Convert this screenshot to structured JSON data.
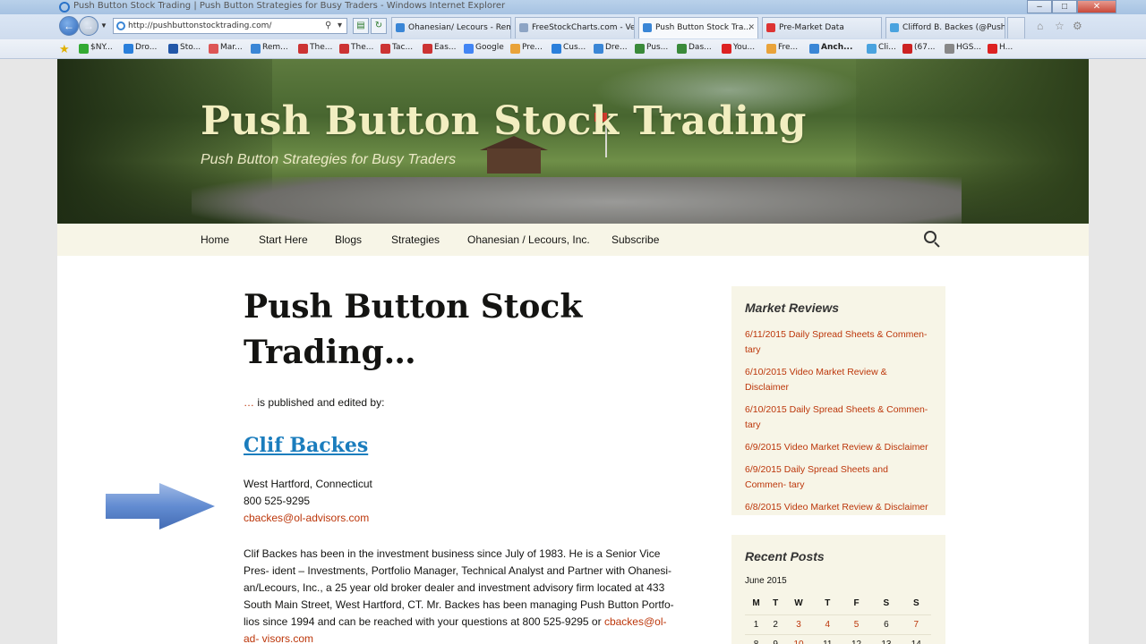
{
  "window": {
    "title": "Push Button Stock Trading | Push Button Strategies for Busy Traders - Windows Internet Explorer",
    "controls": [
      "–",
      "□",
      "✕"
    ]
  },
  "browser": {
    "address": "http://pushbuttonstocktrading.com/",
    "tabs": [
      {
        "label": "Ohanesian/ Lecours - Rem...",
        "active": false
      },
      {
        "label": "FreeStockCharts.com - Ve...",
        "active": false
      },
      {
        "label": "Push Button Stock Tra...",
        "active": true
      },
      {
        "label": "Pre-Market Data",
        "active": false
      },
      {
        "label": "Clifford B. Backes (@Push...",
        "active": false
      }
    ],
    "favorites": [
      "$NY...",
      "Dro...",
      "Sto...",
      "Mar...",
      "Rem...",
      "The...",
      "The...",
      "Tac...",
      "Eas...",
      "Google",
      "Pre...",
      "Cus...",
      "Dre...",
      "Pus...",
      "Das...",
      "You...",
      "Fre...",
      "Anch...",
      "Cli...",
      "(67...",
      "HGS...",
      "H..."
    ]
  },
  "site": {
    "title": "Push Button Stock Trading",
    "tagline": "Push Button Strategies for Busy Traders",
    "nav": [
      "Home",
      "Start Here",
      "Blogs",
      "Strategies",
      "Ohanesian / Lecours, Inc.",
      "Subscribe"
    ]
  },
  "entry": {
    "title": "Push Button Stock Trading…",
    "intro_dots": "…",
    "intro_text": " is published and edited by:",
    "person_name": "Clif Backes",
    "location": "West Hartford, Connecticut",
    "phone": "800 525-9295",
    "email": "cbackes@ol-advisors.com",
    "bio_text": "Clif Backes has been in the investment business since July of 1983. He is a Senior Vice Pres- ident – Investments, Portfolio Manager, Technical Analyst and Partner with Ohanesi- an/Lecours, Inc., a 25 year old broker dealer and investment advisory firm located at 433 South Main Street, West Hartford, CT.  Mr. Backes has been managing Push Button Portfo- lios since 1994 and can be reached with your questions at 800 525-9295 or ",
    "bio_email": "cbackes@ol-ad- visors.com"
  },
  "sidebar": {
    "market_reviews": {
      "title": "Market Reviews",
      "items": [
        "6/11/2015 Daily Spread Sheets & Commen- tary",
        "6/10/2015 Video Market Review & Disclaimer",
        "6/10/2015 Daily Spread Sheets & Commen- tary",
        "6/9/2015 Video Market Review & Disclaimer",
        "6/9/2015 Daily Spread Sheets and Commen- tary",
        "6/8/2015 Video Market Review & Disclaimer"
      ]
    },
    "recent_posts": {
      "title": "Recent Posts",
      "month": "June 2015",
      "weekdays": [
        "M",
        "T",
        "W",
        "T",
        "F",
        "S",
        "S"
      ],
      "week1": [
        "1",
        "2",
        "3",
        "4",
        "5",
        "6",
        "7"
      ],
      "week2": [
        "8",
        "9",
        "10",
        "11",
        "12",
        "13",
        "14"
      ]
    }
  },
  "colors": {
    "accent_link": "#bc360a",
    "person_link": "#1b7dbd",
    "nav_bg": "#f7f5e7",
    "title_text": "#f2eec0"
  }
}
